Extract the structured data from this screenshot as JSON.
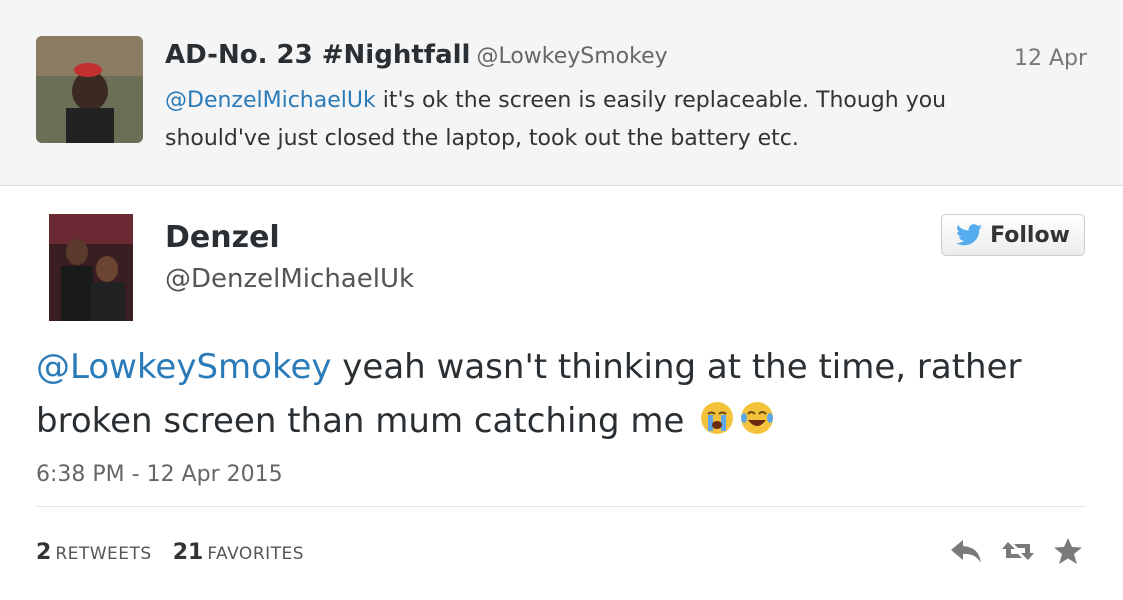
{
  "parent_tweet": {
    "name": "AD-No. 23 #Nightfall",
    "handle": "@LowkeySmokey",
    "time": "12 Apr",
    "mention": "@DenzelMichaelUk",
    "text": " it's ok the screen is easily replaceable. Though you should've just closed the laptop, took out the battery etc."
  },
  "tweet": {
    "name": "Denzel",
    "handle": "@DenzelMichaelUk",
    "follow_label": "Follow",
    "mention": "@LowkeySmokey",
    "text": " yeah wasn't thinking at the time, rather broken screen than mum catching me",
    "timestamp": "6:38 PM - 12 Apr 2015",
    "retweets_count": "2",
    "retweets_label": "RETWEETS",
    "favorites_count": "21",
    "favorites_label": "FAVORITES"
  },
  "colors": {
    "link": "#2b7bb9",
    "twitter_blue": "#55acee",
    "icon_gray": "#7a7a7a"
  },
  "icons": [
    "twitter-bird-icon",
    "crying-face-emoji",
    "tears-of-joy-emoji",
    "reply-icon",
    "retweet-icon",
    "favorite-star-icon"
  ]
}
